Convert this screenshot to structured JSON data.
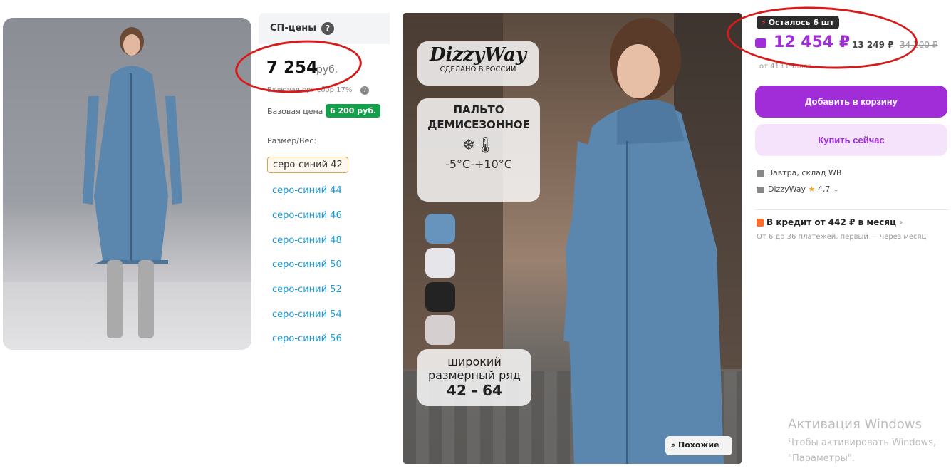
{
  "left_panel": {
    "sp_title": "СП-цены",
    "help": "?",
    "price": "7 254",
    "price_unit": "руб.",
    "fee_text": "Включая орг сбор 17%",
    "base_label": "Базовая цена",
    "base_price": "6 200 руб.",
    "size_label": "Размер/Вес:",
    "sizes": [
      {
        "label": "серо-синий 42"
      },
      {
        "label": "серо-синий 44"
      },
      {
        "label": "серо-синий 46"
      },
      {
        "label": "серо-синий 48"
      },
      {
        "label": "серо-синий 50"
      },
      {
        "label": "серо-синий 52"
      },
      {
        "label": "серо-синий 54"
      },
      {
        "label": "серо-синий 56"
      }
    ],
    "selected_size": "серо-синий 42"
  },
  "product_image": {
    "brand": "DizzyWay",
    "made_in": "СДЕЛАНО В РОССИИ",
    "coat_type_line1": "ПАЛЬТО",
    "coat_type_line2": "ДЕМИСЕЗОННОЕ",
    "temperature": "-5°C-+10°C",
    "swatch_colors": [
      "#6694bd",
      "#e6e6ea",
      "#232323",
      "#d6cfcf"
    ],
    "wide_line1": "широкий",
    "wide_line2": "размерный ряд",
    "size_range": "42 - 64",
    "similar_button": "Похожие",
    "coat_color": "#5b87ae"
  },
  "right_panel": {
    "stock_badge": "Осталось 6 шт",
    "wb_price": "12 454 ₽",
    "price_without_wallet": "13 249 ₽",
    "old_price": "34 200 ₽",
    "points": "от 413 Рэллов",
    "add_to_cart": "Добавить в корзину",
    "buy_now": "Купить сейчас",
    "delivery": "Завтра, склад WB",
    "seller": "DizzyWay",
    "rating": "4,7",
    "credit": "В кредит от 442 ₽ в месяц",
    "credit_sub": "От 6 до 36 платежей, первый — через месяц",
    "accent_color": "#a12dd8"
  },
  "watermark": {
    "line1": "Активация Windows",
    "line2": "Чтобы активировать Windows,",
    "line3": "\"Параметры\"."
  }
}
